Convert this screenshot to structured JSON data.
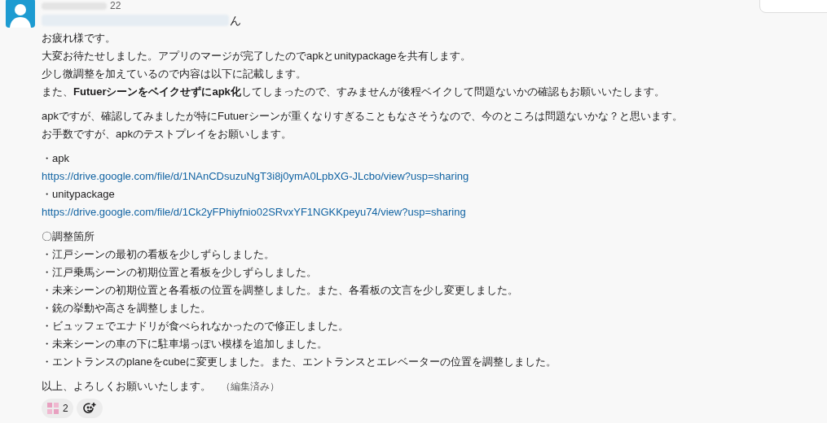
{
  "message": {
    "time": "22",
    "mention": "ん",
    "blocks": [
      {
        "lines": [
          {
            "kind": "text",
            "text": "お疲れ様です。"
          },
          {
            "kind": "text",
            "text": "大変お待たせしました。アプリのマージが完了したのでapkとunitypackageを共有します。"
          },
          {
            "kind": "text",
            "text": "少し微調整を加えているので内容は以下に記載します。"
          },
          {
            "kind": "text",
            "text": "また、**Futuerシーンをベイクせずにapk化**してしまったので、すみませんが後程ベイクして問題ないかの確認もお願いいたします。"
          }
        ]
      },
      {
        "lines": [
          {
            "kind": "text",
            "text": "apkですが、確認してみましたが特にFutuerシーンが重くなりすぎることもなさそうなので、今のところは問題ないかな？と思います。"
          },
          {
            "kind": "text",
            "text": "お手数ですが、apkのテストプレイをお願いします。"
          }
        ]
      },
      {
        "lines": [
          {
            "kind": "text",
            "text": "・apk"
          },
          {
            "kind": "link",
            "text": "https://drive.google.com/file/d/1NAnCDsuzuNgT3i8j0ymA0LpbXG-JLcbo/view?usp=sharing"
          },
          {
            "kind": "text",
            "text": "・unitypackage"
          },
          {
            "kind": "link",
            "text": "https://drive.google.com/file/d/1Ck2yFPhiyfnio02SRvxYF1NGKKpeyu74/view?usp=sharing"
          }
        ]
      },
      {
        "lines": [
          {
            "kind": "text",
            "text": "〇調整箇所"
          },
          {
            "kind": "text",
            "text": "・江戸シーンの最初の看板を少しずらしました。"
          },
          {
            "kind": "text",
            "text": "・江戸乗馬シーンの初期位置と看板を少しずらしました。"
          },
          {
            "kind": "text",
            "text": "・未来シーンの初期位置と各看板の位置を調整しました。また、各看板の文言を少し変更しました。"
          },
          {
            "kind": "text",
            "text": "・銃の挙動や高さを調整しました。"
          },
          {
            "kind": "text",
            "text": "・ビュッフェでエナドリが食べられなかったので修正しました。"
          },
          {
            "kind": "text",
            "text": "・未来シーンの車の下に駐車場っぽい模様を追加しました。"
          },
          {
            "kind": "text",
            "text": "・エントランスのplaneをcubeに変更しました。また、エントランスとエレベーターの位置を調整しました。"
          }
        ]
      },
      {
        "lines": [
          {
            "kind": "text",
            "text": "以上、よろしくお願いいたします。",
            "edited": "（編集済み）"
          }
        ]
      }
    ],
    "reactions": [
      {
        "count": "2"
      }
    ]
  }
}
